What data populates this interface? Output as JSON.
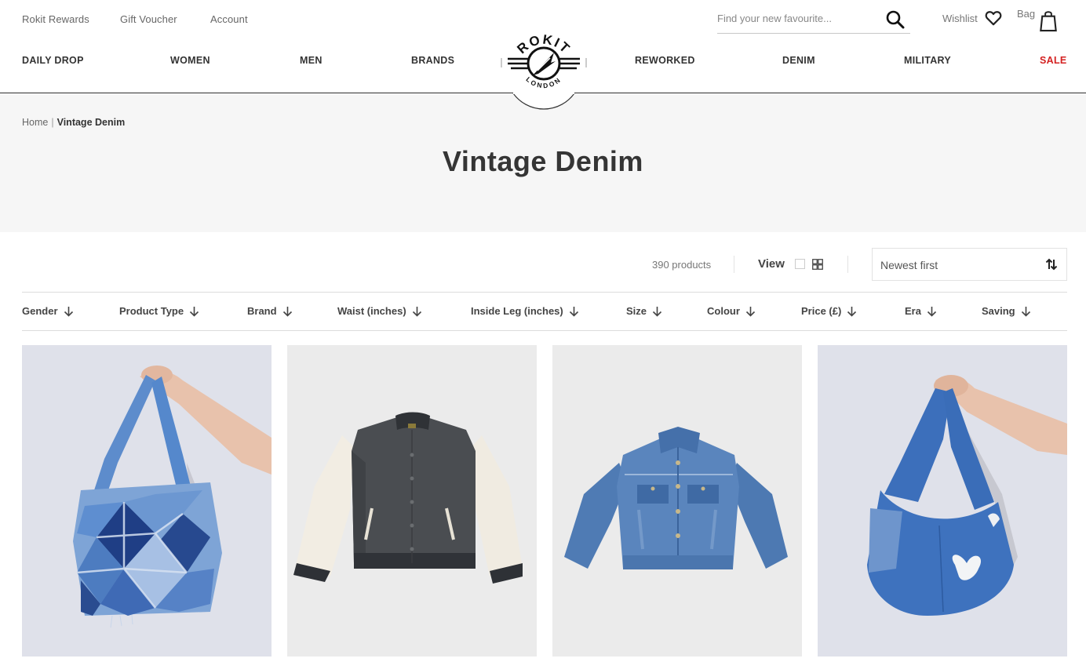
{
  "utility_links": [
    {
      "label": "Rokit Rewards"
    },
    {
      "label": "Gift Voucher"
    },
    {
      "label": "Account"
    }
  ],
  "search": {
    "placeholder": "Find your new favourite...",
    "value": "",
    "icon": "search-icon"
  },
  "wishlist": {
    "label": "Wishlist",
    "icon": "heart-icon"
  },
  "bag": {
    "label": "Bag",
    "icon": "shopping-bag-icon"
  },
  "logo": {
    "top_text": "ROKIT",
    "bottom_text": "LONDON"
  },
  "nav": [
    {
      "label": "DAILY DROP"
    },
    {
      "label": "WOMEN"
    },
    {
      "label": "MEN"
    },
    {
      "label": "BRANDS"
    },
    {
      "label": "REWORKED"
    },
    {
      "label": "DENIM"
    },
    {
      "label": "MILITARY"
    },
    {
      "label": "SALE",
      "color": "#d42121"
    }
  ],
  "breadcrumb": {
    "home": "Home",
    "separator": "|",
    "current": "Vintage Denim"
  },
  "page_title": "Vintage Denim",
  "toolbar": {
    "product_count": "390 products",
    "view_label": "View",
    "view_options": [
      "single-view-icon",
      "grid-view-icon"
    ],
    "sort": {
      "selected": "Newest first",
      "icon": "sort-arrows-icon"
    }
  },
  "filters": [
    {
      "label": "Gender"
    },
    {
      "label": "Product Type"
    },
    {
      "label": "Brand"
    },
    {
      "label": "Waist (inches)"
    },
    {
      "label": "Inside Leg (inches)"
    },
    {
      "label": "Size"
    },
    {
      "label": "Colour"
    },
    {
      "label": "Price (£)"
    },
    {
      "label": "Era"
    },
    {
      "label": "Saving"
    }
  ],
  "products": [
    {
      "image": "patchwork-denim-shoulder-bag"
    },
    {
      "image": "grey-varsity-bomber-jacket-cream-sleeves"
    },
    {
      "image": "blue-denim-trucker-jacket"
    },
    {
      "image": "blue-denim-hobo-bag-with-butterfly-patches"
    }
  ],
  "colors": {
    "sale": "#d42121",
    "text": "#333333",
    "hero_bg": "#f6f6f6"
  }
}
